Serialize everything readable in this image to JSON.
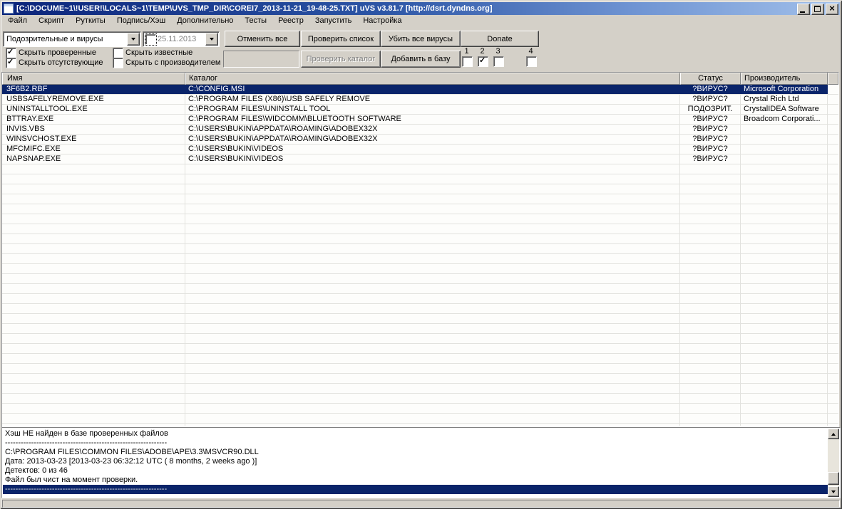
{
  "window": {
    "title": "[C:\\DOCUME~1\\!USER!\\LOCALS~1\\TEMP\\UVS_TMP_DIR\\COREI7_2013-11-21_19-48-25.TXT] uVS v3.81.7 [http://dsrt.dyndns.org]"
  },
  "menu": {
    "items": [
      "Файл",
      "Скрипт",
      "Руткиты",
      "Подпись/Хэш",
      "Дополнительно",
      "Тесты",
      "Реестр",
      "Запустить",
      "Настройка"
    ]
  },
  "toolbar": {
    "filter_combo": {
      "value": "Подозрительные и вирусы"
    },
    "date_combo": {
      "value": "25.11.2013",
      "checked": false
    },
    "buttons": {
      "cancel_all": "Отменить все",
      "check_list": "Проверить список",
      "kill_all": "Убить все вирусы",
      "donate": "Donate",
      "check_dir": "Проверить каталог",
      "add_to_base": "Добавить в базу"
    },
    "hide_checkboxes": [
      {
        "label": "Скрыть проверенные",
        "checked": true
      },
      {
        "label": "Скрыть известные",
        "checked": false
      },
      {
        "label": "Скрыть отсутствующие",
        "checked": true
      },
      {
        "label": "Скрыть с производителем",
        "checked": false
      }
    ],
    "path_input": {
      "value": ""
    },
    "numbered_checkboxes": [
      {
        "label": "1",
        "checked": false
      },
      {
        "label": "2",
        "checked": true
      },
      {
        "label": "3",
        "checked": false
      },
      {
        "label": "4",
        "checked": false
      }
    ]
  },
  "table": {
    "columns": [
      "Имя",
      "Каталог",
      "Статус",
      "Производитель"
    ],
    "rows": [
      {
        "name": "3F6B2.RBF",
        "dir": "C:\\CONFIG.MSI",
        "status": "?ВИРУС?",
        "vendor": "Microsoft Corporation",
        "selected": true
      },
      {
        "name": "USBSAFELYREMOVE.EXE",
        "dir": "C:\\PROGRAM FILES (X86)\\USB SAFELY REMOVE",
        "status": "?ВИРУС?",
        "vendor": "Crystal Rich Ltd",
        "selected": false
      },
      {
        "name": "UNINSTALLTOOL.EXE",
        "dir": "C:\\PROGRAM FILES\\UNINSTALL TOOL",
        "status": "ПОДОЗРИТ.",
        "vendor": "CrystalIDEA Software",
        "selected": false
      },
      {
        "name": "BTTRAY.EXE",
        "dir": "C:\\PROGRAM FILES\\WIDCOMM\\BLUETOOTH SOFTWARE",
        "status": "?ВИРУС?",
        "vendor": "Broadcom Corporati...",
        "selected": false
      },
      {
        "name": "INVIS.VBS",
        "dir": "C:\\USERS\\BUKIN\\APPDATA\\ROAMING\\ADOBEX32X",
        "status": "?ВИРУС?",
        "vendor": "",
        "selected": false
      },
      {
        "name": "WINSVCHOST.EXE",
        "dir": "C:\\USERS\\BUKIN\\APPDATA\\ROAMING\\ADOBEX32X",
        "status": "?ВИРУС?",
        "vendor": "",
        "selected": false
      },
      {
        "name": "MFCMIFC.EXE",
        "dir": "C:\\USERS\\BUKIN\\VIDEOS",
        "status": "?ВИРУС?",
        "vendor": "",
        "selected": false
      },
      {
        "name": "NAPSNAP.EXE",
        "dir": "C:\\USERS\\BUKIN\\VIDEOS",
        "status": "?ВИРУС?",
        "vendor": "",
        "selected": false
      }
    ]
  },
  "info_panel": {
    "lines": [
      {
        "text": "Хэш НЕ найден в базе проверенных файлов",
        "selected": false
      },
      {
        "text": "--------------------------------------------------------------",
        "selected": false
      },
      {
        "text": "C:\\PROGRAM FILES\\COMMON FILES\\ADOBE\\APE\\3.3\\MSVCR90.DLL",
        "selected": false
      },
      {
        "text": "Дата: 2013-03-23 [2013-03-23 06:32:12 UTC ( 8 months, 2 weeks ago )]",
        "selected": false
      },
      {
        "text": "Детектов: 0 из 46",
        "selected": false
      },
      {
        "text": "Файл был чист на момент проверки.",
        "selected": false
      },
      {
        "text": "--------------------------------------------------------------",
        "selected": true
      }
    ]
  },
  "colors": {
    "selection": "#0a246a",
    "face": "#d4d0c8",
    "titlebar_left": "#0b247a",
    "titlebar_right": "#a2c0ea"
  }
}
